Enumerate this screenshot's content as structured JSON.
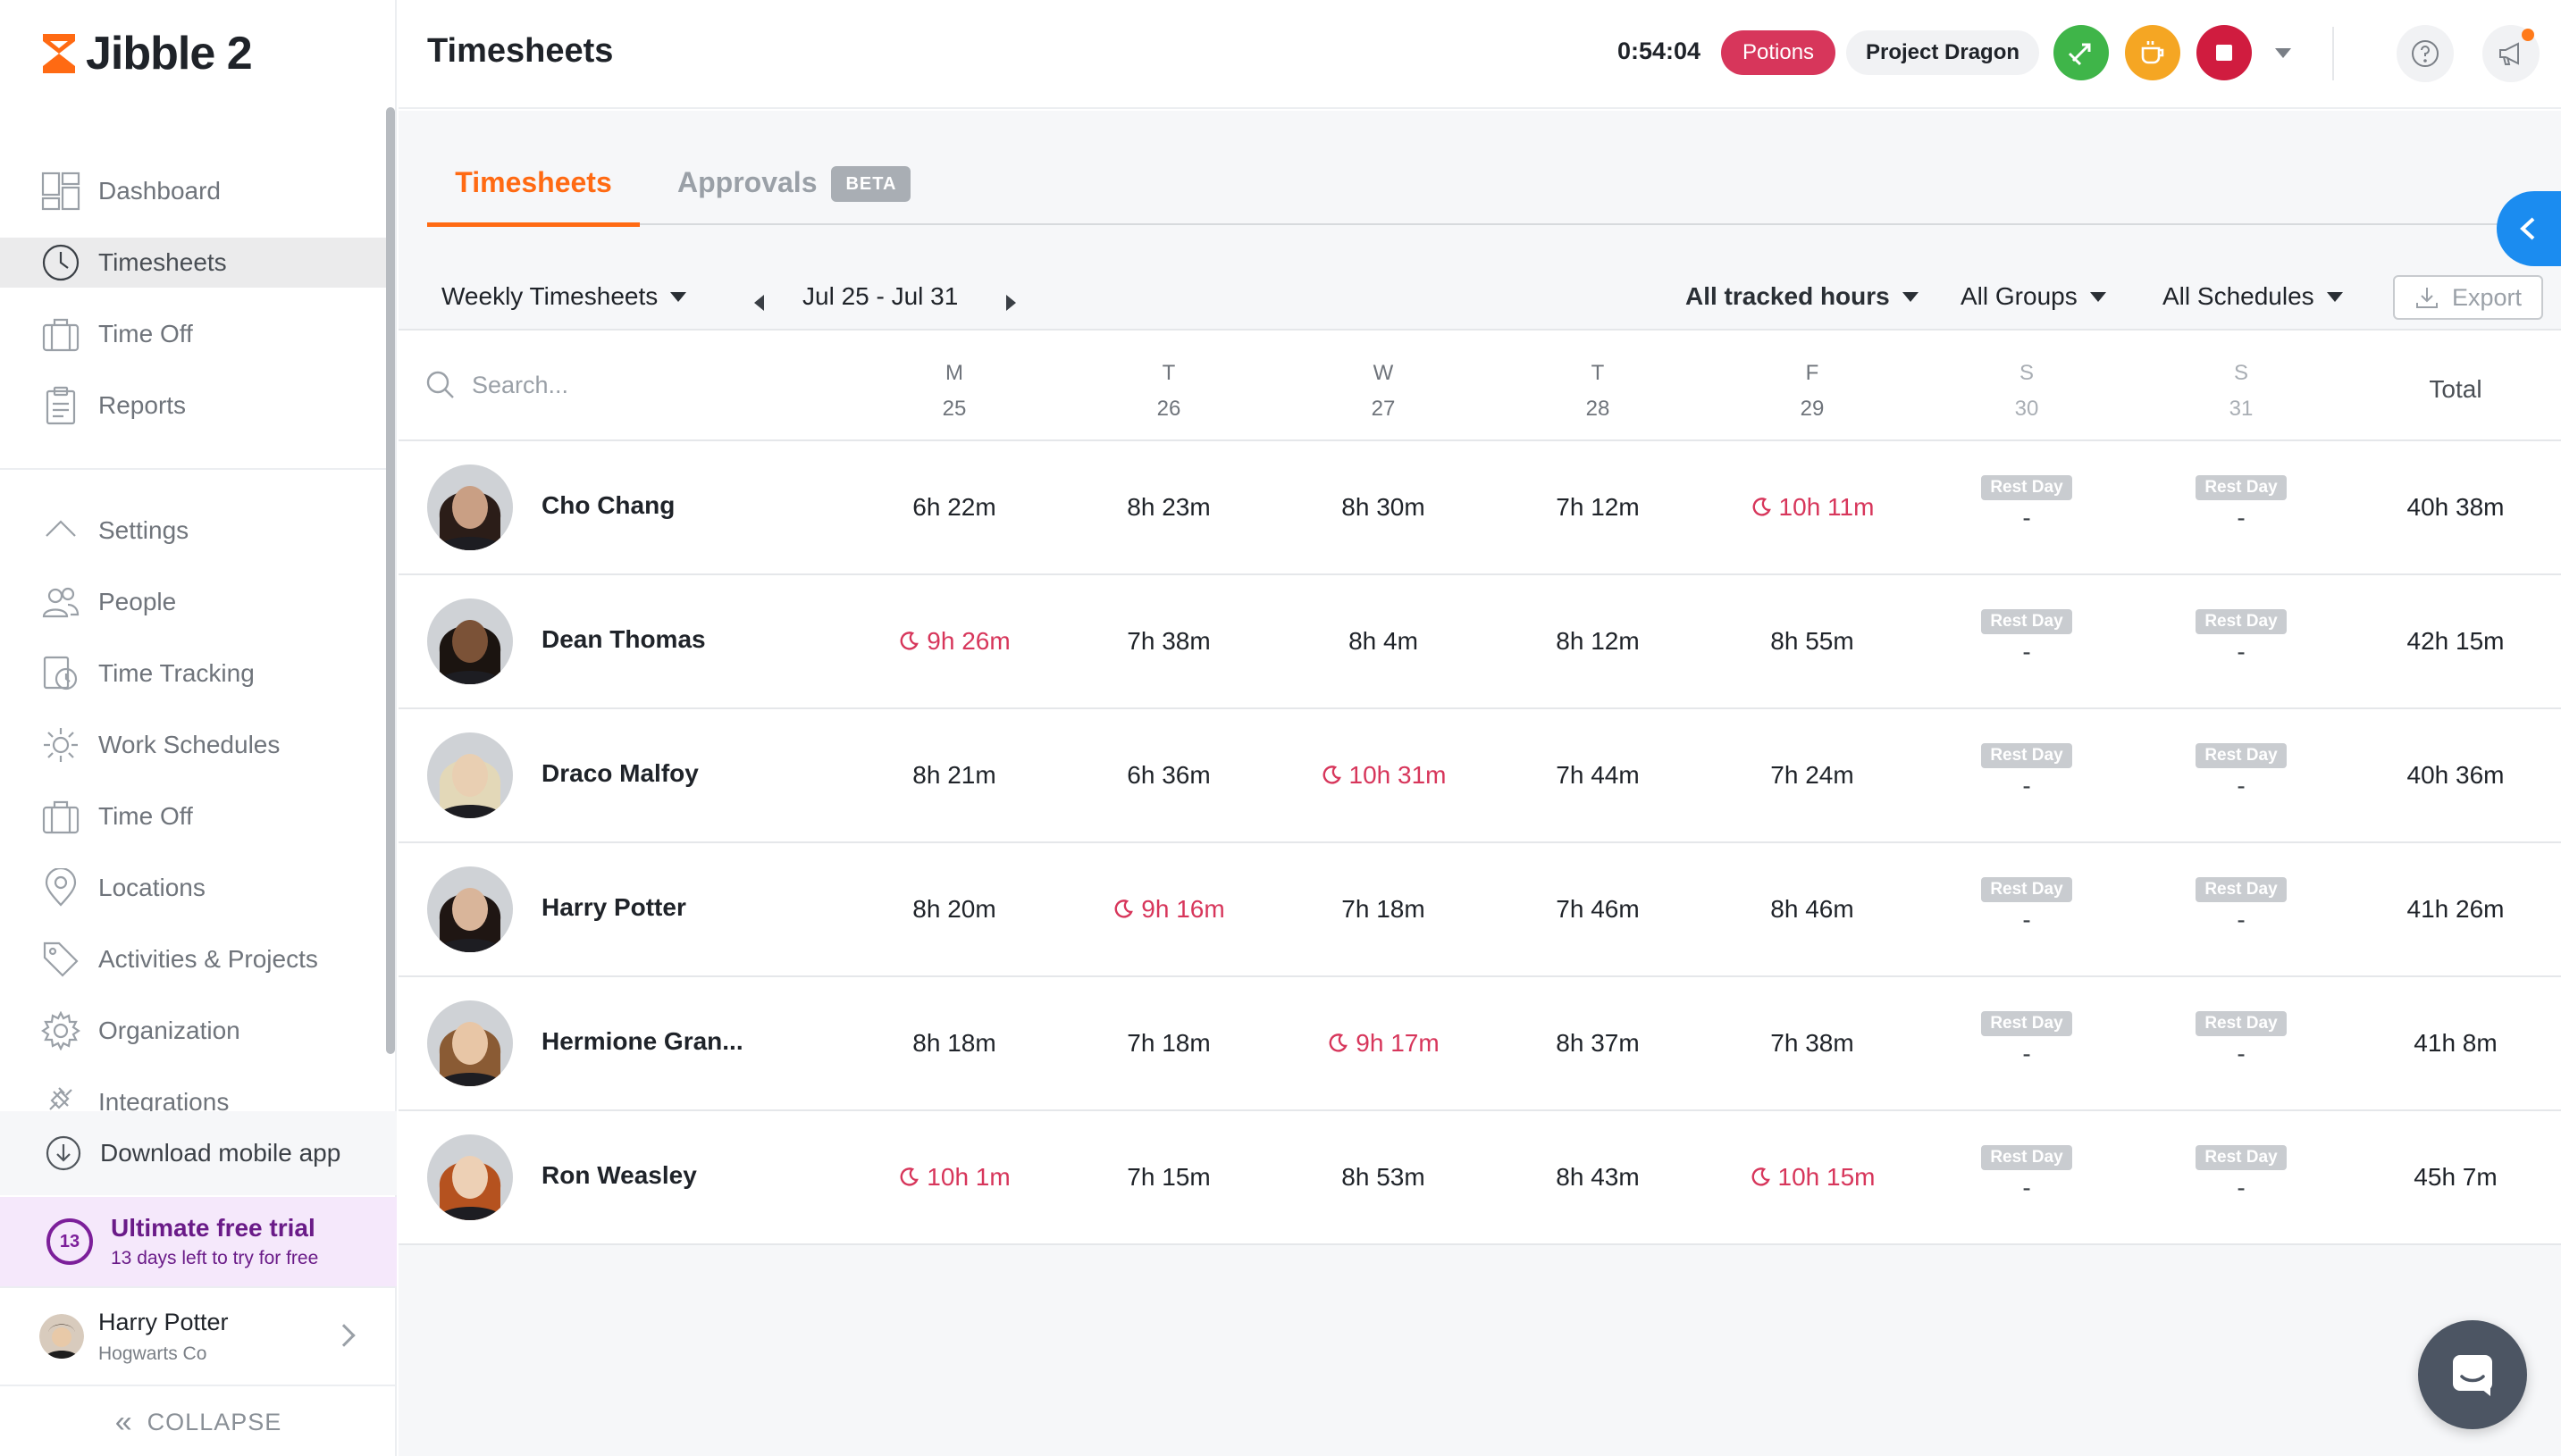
{
  "app": {
    "name": "Jibble 2"
  },
  "sidebar": {
    "nav_top": [
      {
        "label": "Dashboard",
        "icon": "dashboard-icon"
      },
      {
        "label": "Timesheets",
        "icon": "clock-icon",
        "active": true
      },
      {
        "label": "Time Off",
        "icon": "suitcase-icon"
      },
      {
        "label": "Reports",
        "icon": "clipboard-icon"
      }
    ],
    "nav_settings": [
      {
        "label": "Settings",
        "icon": "chevron-up-icon"
      },
      {
        "label": "People",
        "icon": "people-icon"
      },
      {
        "label": "Time Tracking",
        "icon": "time-tracking-icon"
      },
      {
        "label": "Work Schedules",
        "icon": "schedule-icon"
      },
      {
        "label": "Time Off",
        "icon": "suitcase-icon"
      },
      {
        "label": "Locations",
        "icon": "location-pin-icon"
      },
      {
        "label": "Activities & Projects",
        "icon": "tag-icon"
      },
      {
        "label": "Organization",
        "icon": "gear-icon"
      },
      {
        "label": "Integrations",
        "icon": "plug-icon"
      }
    ],
    "download_label": "Download mobile app",
    "trial": {
      "days": "13",
      "title": "Ultimate free trial",
      "subtitle": "13 days left to try for free"
    },
    "user": {
      "name": "Harry Potter",
      "company": "Hogwarts Co"
    },
    "collapse_label": "COLLAPSE"
  },
  "header": {
    "title": "Timesheets",
    "timer": "0:54:04",
    "activity": "Potions",
    "project": "Project Dragon",
    "colors": {
      "activity": "#d7365b",
      "switch": "#3fb549",
      "break": "#f5a623",
      "stop": "#d01c3f"
    }
  },
  "tabs": {
    "timesheets": "Timesheets",
    "approvals": "Approvals",
    "beta": "BETA"
  },
  "toolbar": {
    "view": "Weekly Timesheets",
    "range": "Jul 25 - Jul 31",
    "hours_filter": "All tracked hours",
    "groups_filter": "All Groups",
    "schedules_filter": "All Schedules",
    "export_label": "Export"
  },
  "table": {
    "search_placeholder": "Search...",
    "days": [
      {
        "letter": "M",
        "date": "25",
        "rest": false
      },
      {
        "letter": "T",
        "date": "26",
        "rest": false
      },
      {
        "letter": "W",
        "date": "27",
        "rest": false
      },
      {
        "letter": "T",
        "date": "28",
        "rest": false
      },
      {
        "letter": "F",
        "date": "29",
        "rest": false
      },
      {
        "letter": "S",
        "date": "30",
        "rest": true
      },
      {
        "letter": "S",
        "date": "31",
        "rest": true
      }
    ],
    "total_label": "Total",
    "rest_label": "Rest Day",
    "rest_value": "-",
    "rows": [
      {
        "name": "Cho Chang",
        "cells": [
          {
            "v": "6h 22m"
          },
          {
            "v": "8h 23m"
          },
          {
            "v": "8h 30m"
          },
          {
            "v": "7h 12m"
          },
          {
            "v": "10h 11m",
            "ot": true
          }
        ],
        "total": "40h 38m"
      },
      {
        "name": "Dean Thomas",
        "cells": [
          {
            "v": "9h 26m",
            "ot": true
          },
          {
            "v": "7h 38m"
          },
          {
            "v": "8h 4m"
          },
          {
            "v": "8h 12m"
          },
          {
            "v": "8h 55m"
          }
        ],
        "total": "42h 15m"
      },
      {
        "name": "Draco Malfoy",
        "cells": [
          {
            "v": "8h 21m"
          },
          {
            "v": "6h 36m"
          },
          {
            "v": "10h 31m",
            "ot": true
          },
          {
            "v": "7h 44m"
          },
          {
            "v": "7h 24m"
          }
        ],
        "total": "40h 36m"
      },
      {
        "name": "Harry Potter",
        "cells": [
          {
            "v": "8h 20m"
          },
          {
            "v": "9h 16m",
            "ot": true
          },
          {
            "v": "7h 18m"
          },
          {
            "v": "7h 46m"
          },
          {
            "v": "8h 46m"
          }
        ],
        "total": "41h 26m"
      },
      {
        "name": "Hermione Gran...",
        "cells": [
          {
            "v": "8h 18m"
          },
          {
            "v": "7h 18m"
          },
          {
            "v": "9h 17m",
            "ot": true
          },
          {
            "v": "8h 37m"
          },
          {
            "v": "7h 38m"
          }
        ],
        "total": "41h 8m"
      },
      {
        "name": "Ron Weasley",
        "cells": [
          {
            "v": "10h 1m",
            "ot": true
          },
          {
            "v": "7h 15m"
          },
          {
            "v": "8h 53m"
          },
          {
            "v": "8h 43m"
          },
          {
            "v": "10h 15m",
            "ot": true
          }
        ],
        "total": "45h 7m"
      }
    ]
  }
}
